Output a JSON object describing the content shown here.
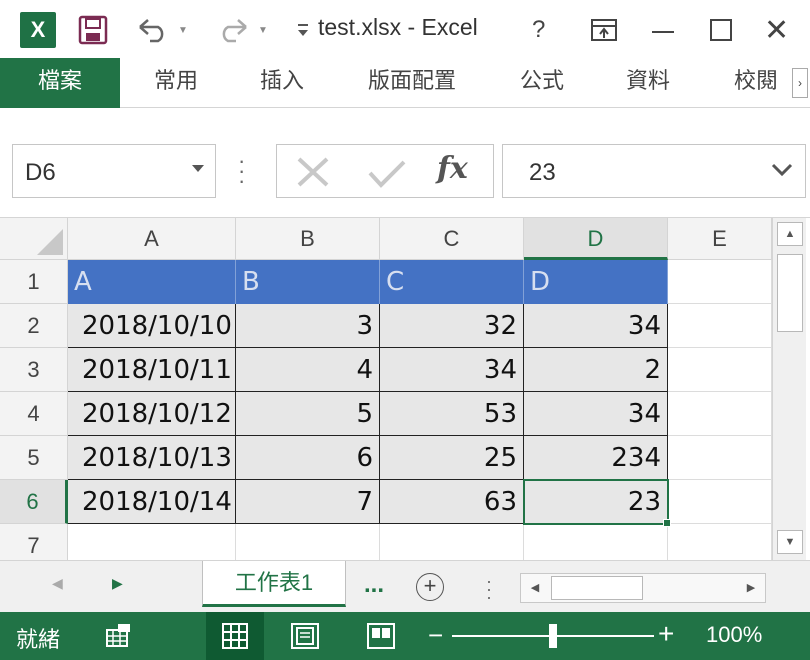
{
  "window": {
    "title": "test.xlsx - Excel",
    "app_logo": "X",
    "help": "?",
    "close": "✕"
  },
  "ribbon": {
    "tabs": [
      "檔案",
      "常用",
      "插入",
      "版面配置",
      "公式",
      "資料",
      "校閱"
    ],
    "scroll_icon": "›"
  },
  "formula_bar": {
    "name_box": "D6",
    "fx": "fx",
    "value": "23"
  },
  "grid": {
    "columns": [
      "A",
      "B",
      "C",
      "D",
      "E"
    ],
    "selected_column": "D",
    "rows": [
      "1",
      "2",
      "3",
      "4",
      "5",
      "6",
      "7"
    ],
    "selected_row": "6",
    "header_row": [
      "A",
      "B",
      "C",
      "D"
    ],
    "data": [
      [
        "2018/10/10",
        "3",
        "32",
        "34"
      ],
      [
        "2018/10/11",
        "4",
        "34",
        "2"
      ],
      [
        "2018/10/12",
        "5",
        "53",
        "34"
      ],
      [
        "2018/10/13",
        "6",
        "25",
        "234"
      ],
      [
        "2018/10/14",
        "7",
        "63",
        "23"
      ]
    ]
  },
  "sheet_tabs": {
    "active": "工作表1",
    "more": "...",
    "add": "+"
  },
  "status_bar": {
    "ready": "就緒",
    "zoom": "100%",
    "zoom_fraction": 0.5
  },
  "colors": {
    "accent": "#217346",
    "table_header": "#4472c4",
    "cell_fill": "#e7e7e7"
  }
}
